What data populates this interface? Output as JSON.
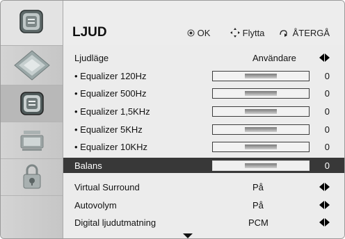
{
  "header": {
    "title": "LJUD",
    "ok_label": "OK",
    "move_label": "Flytta",
    "back_label": "ÅTERGÅ"
  },
  "sidebar": {
    "icons": [
      "picture-icon",
      "sound-icon",
      "time-icon",
      "lock-icon"
    ],
    "selected": "sound-icon"
  },
  "rows": [
    {
      "label": "Ljudläge",
      "value": "Användare"
    },
    {
      "label": "• Equalizer 120Hz",
      "value": "0",
      "level": 0.5
    },
    {
      "label": "• Equalizer 500Hz",
      "value": "0",
      "level": 0.5
    },
    {
      "label": "• Equalizer 1,5KHz",
      "value": "0",
      "level": 0.5
    },
    {
      "label": "• Equalizer 5KHz",
      "value": "0",
      "level": 0.5
    },
    {
      "label": "• Equalizer 10KHz",
      "value": "0",
      "level": 0.5
    },
    {
      "label": "Balans",
      "value": "0",
      "level": 0.5,
      "selected": true
    },
    {
      "label": "Virtual Surround",
      "value": "På"
    },
    {
      "label": "Autovolym",
      "value": "På"
    },
    {
      "label": "Digital ljudutmatning",
      "value": "PCM"
    }
  ],
  "colors": {
    "selected_row": "#383838",
    "background": "#ececec"
  }
}
